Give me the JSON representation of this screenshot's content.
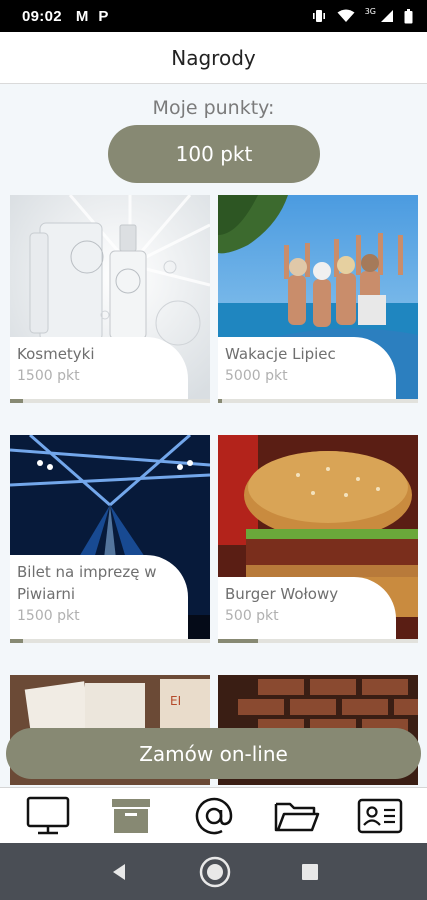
{
  "status": {
    "time": "09:02",
    "notifications": [
      "M",
      "P"
    ],
    "network": "3G"
  },
  "header": {
    "title": "Nagrody"
  },
  "points": {
    "label": "Moje punkty:",
    "value": "100 pkt"
  },
  "rewards": [
    {
      "title": "Kosmetyki",
      "points": "1500 pkt",
      "progress": 0.067,
      "image": "cosmetics-photo"
    },
    {
      "title": "Wakacje Lipiec",
      "points": "5000 pkt",
      "progress": 0.02,
      "image": "vacation-beach-photo"
    },
    {
      "title": "Bilet na imprezę w Piwiarni",
      "points": "1500 pkt",
      "progress": 0.067,
      "image": "concert-stage-photo"
    },
    {
      "title": "Burger Wołowy",
      "points": "500 pkt",
      "progress": 0.2,
      "image": "burger-photo"
    },
    {
      "title": "",
      "points": "",
      "progress": 0,
      "image": "menu-cards-photo"
    },
    {
      "title": "",
      "points": "",
      "progress": 0,
      "image": "brick-wall-photo"
    }
  ],
  "order_button": {
    "label": "Zamów on-line"
  },
  "bottom_nav": [
    {
      "icon": "monitor-icon"
    },
    {
      "icon": "archive-box-icon"
    },
    {
      "icon": "at-sign-icon"
    },
    {
      "icon": "folder-icon"
    },
    {
      "icon": "contact-card-icon"
    }
  ],
  "colors": {
    "accent": "#878973",
    "active_nav": "#878973"
  }
}
